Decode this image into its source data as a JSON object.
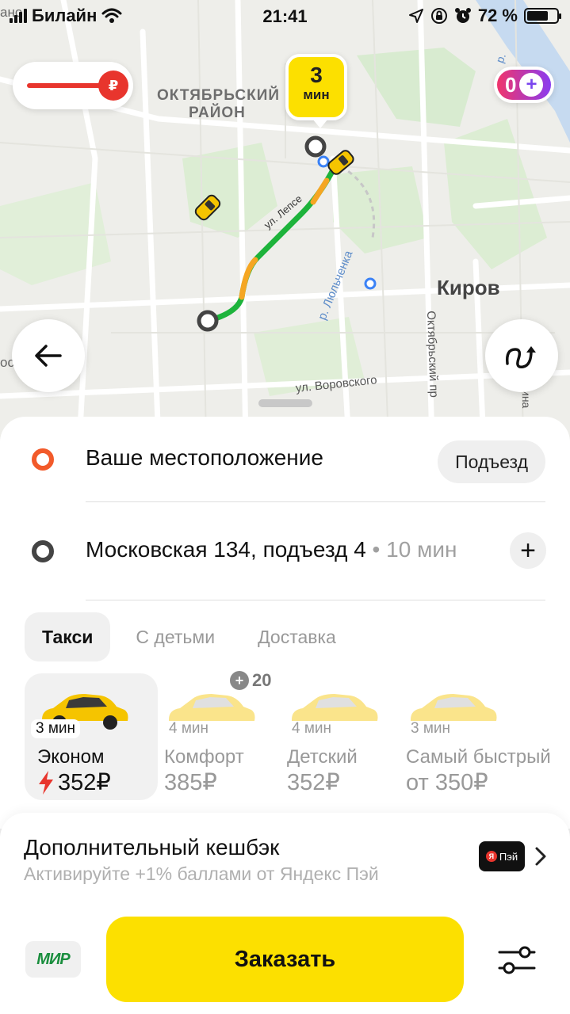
{
  "status_bar": {
    "carrier": "Билайн",
    "time": "21:41",
    "battery_percent": "72 %",
    "battery_level": 0.72
  },
  "map": {
    "district_label_line1": "ОКТЯБРЬСКИЙ",
    "district_label_line2": "РАЙОН",
    "city_label": "Киров",
    "street_lepse": "ул. Лепсе",
    "river_label": "р. Люльченка",
    "street_vorovskogo": "ул. Воровского",
    "avenue_label": "Октябрьский пр",
    "corner_top_left": "ано",
    "edge_left": "ос",
    "edge_right": "ина",
    "river_top_right": "р.",
    "eta_value": "3",
    "eta_unit": "мин",
    "plus_points": "0",
    "ruble_symbol": "₽"
  },
  "route": {
    "pickup": "Ваше местоположение",
    "entrance_button": "Подъезд",
    "destination": "Московская 134, подъезд 4",
    "destination_time": " • 10 мин",
    "add_stop_symbol": "+"
  },
  "tabs": [
    {
      "label": "Такси",
      "active": true
    },
    {
      "label": "С детьми",
      "active": false
    },
    {
      "label": "Доставка",
      "active": false
    }
  ],
  "tariffs": [
    {
      "name": "Эконом",
      "eta": "3 мин",
      "price": "352₽",
      "selected": true,
      "surge": true
    },
    {
      "name": "Комфорт",
      "eta": "4 мин",
      "price": "385₽",
      "selected": false,
      "bonus": "20"
    },
    {
      "name": "Детский",
      "eta": "4 мин",
      "price": "352₽",
      "selected": false
    },
    {
      "name": "Самый быстрый",
      "eta": "3 мин",
      "price": "от 350₽",
      "selected": false
    }
  ],
  "cashback": {
    "title": "Дополнительный кешбэк",
    "subtitle": "Активируйте +1% баллами от Яндекс Пэй",
    "badge_ya": "Я",
    "badge_text": "Пэй"
  },
  "bottom": {
    "payment_method": "МИР",
    "order_button": "Заказать"
  },
  "colors": {
    "accent_yellow": "#fce000",
    "pickup_orange": "#f25a2a",
    "route_green": "#1db33b",
    "surge_red": "#e8352d"
  }
}
